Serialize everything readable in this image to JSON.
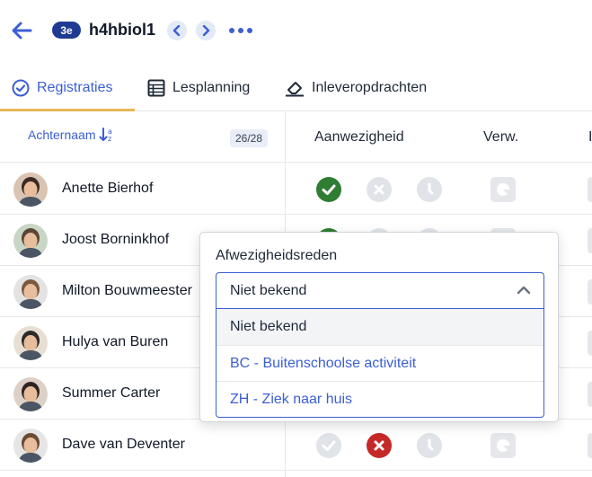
{
  "header": {
    "grade_badge": "3e",
    "class_name": "h4hbiol1"
  },
  "tabs": [
    {
      "label": "Registraties",
      "icon": "check-circle-icon",
      "active": true
    },
    {
      "label": "Lesplanning",
      "icon": "table-icon",
      "active": false
    },
    {
      "label": "Inleveropdrachten",
      "icon": "eraser-icon",
      "active": false
    }
  ],
  "table": {
    "sort_label": "Achternaam",
    "count": "26/28",
    "columns": {
      "attendance": "Aanwezigheid",
      "excused": "Verw.",
      "cut": "I"
    }
  },
  "students": [
    {
      "name": "Anette Bierhof",
      "status": "present"
    },
    {
      "name": "Joost Borninkhof",
      "status": "present"
    },
    {
      "name": "Milton Bouwmeester",
      "status": "none"
    },
    {
      "name": "Hulya van Buren",
      "status": "none"
    },
    {
      "name": "Summer Carter",
      "status": "none"
    },
    {
      "name": "Dave van Deventer",
      "status": "absent"
    }
  ],
  "popover": {
    "label": "Afwezigheidsreden",
    "selected": "Niet bekend",
    "options": [
      "Niet bekend",
      "BC - Buitenschoolse activiteit",
      "ZH - Ziek naar huis"
    ]
  },
  "colors": {
    "accent": "#3b5fd4",
    "present": "#2e7d32",
    "absent": "#c62828",
    "inactive": "#e0e3e8",
    "tab_underline": "#e8b85a",
    "badge": "#1f3a93"
  }
}
